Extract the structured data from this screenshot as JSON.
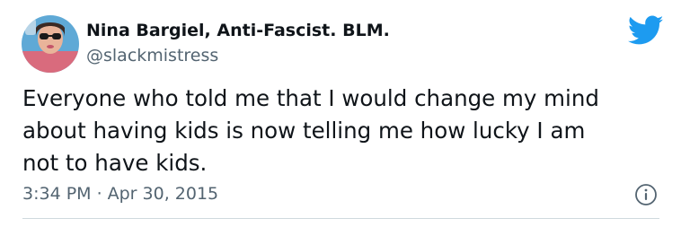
{
  "author": {
    "name": "Nina Bargiel, Anti-Fascist. BLM.",
    "handle": "@slackmistress"
  },
  "tweet": {
    "lines": [
      "Everyone who told me that I would change my mind",
      "about having kids is now telling me how lucky I am",
      "not to have kids."
    ],
    "time": "3:34 PM",
    "separator": "·",
    "date": "Apr 30, 2015"
  },
  "icons": {
    "brand": "twitter-bird-icon",
    "info": "info-icon"
  },
  "colors": {
    "brand_blue": "#1d9bf0",
    "text_primary": "#0f1419",
    "text_secondary": "#536471",
    "divider": "#cfd9de"
  }
}
